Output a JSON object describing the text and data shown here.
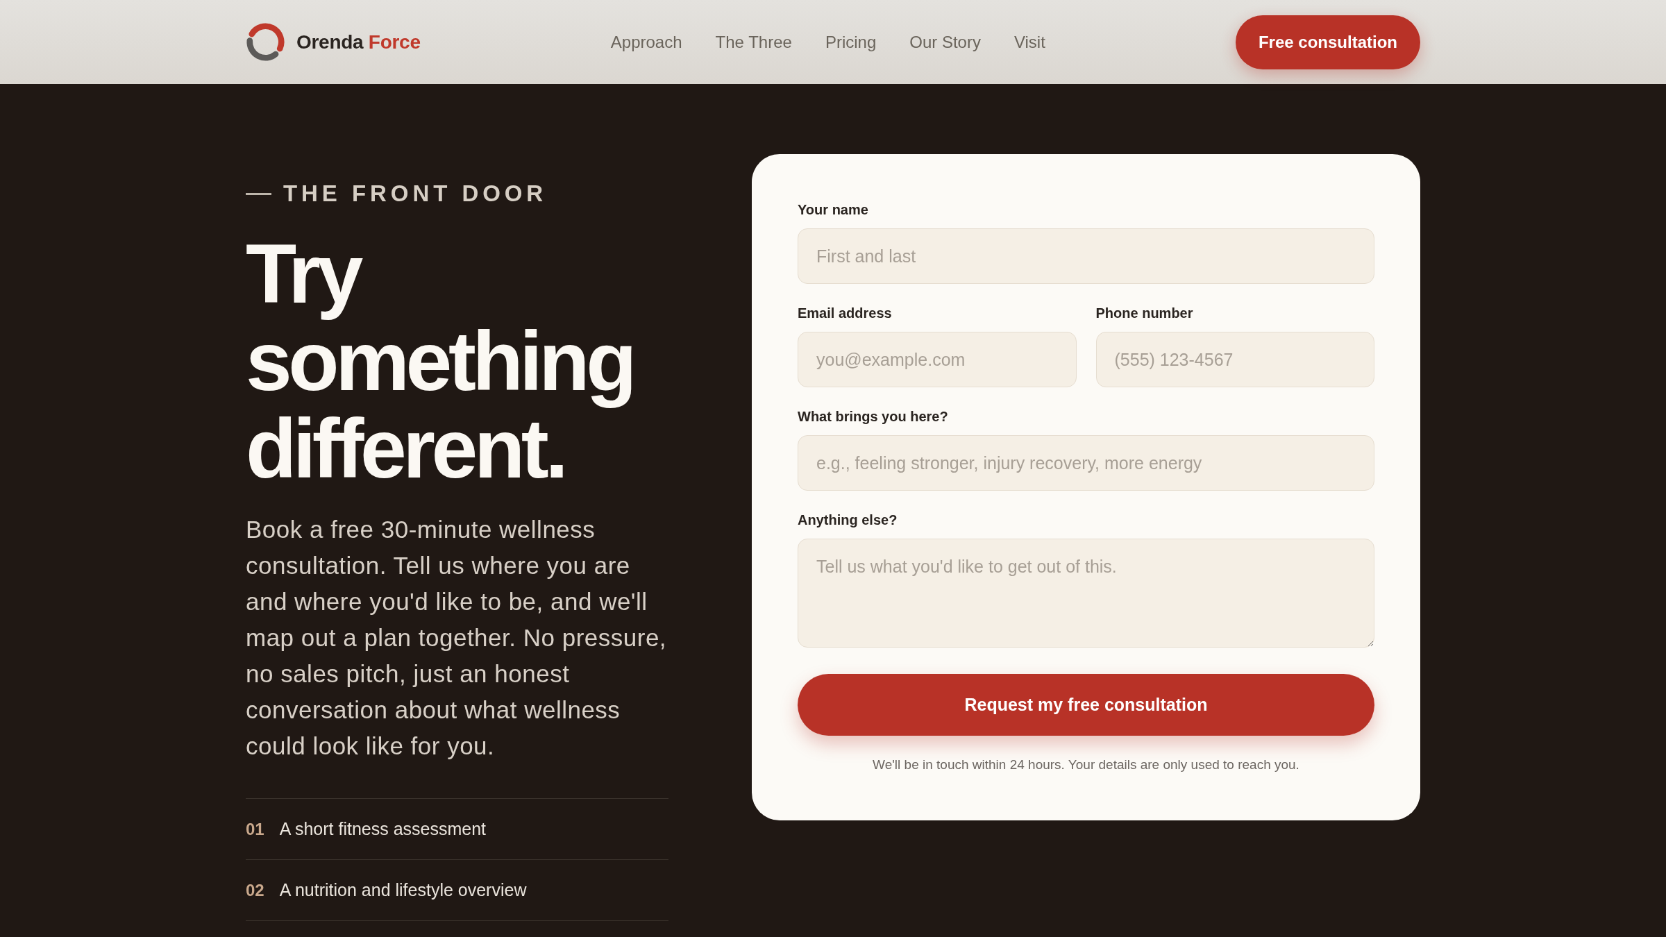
{
  "header": {
    "brand": {
      "name": "Orenda",
      "accent": "Force"
    },
    "nav": [
      {
        "label": "Approach"
      },
      {
        "label": "The Three"
      },
      {
        "label": "Pricing"
      },
      {
        "label": "Our Story"
      },
      {
        "label": "Visit"
      }
    ],
    "cta": "Free consultation"
  },
  "hero": {
    "eyebrow": "THE FRONT DOOR",
    "title": "Try something different.",
    "intro": "Book a free 30-minute wellness consultation. Tell us where you are and where you'd like to be, and we'll map out a plan together. No pressure, no sales pitch, just an honest conversation about what wellness could look like for you.",
    "steps": [
      {
        "number": "01",
        "text": "A short fitness assessment"
      },
      {
        "number": "02",
        "text": "A nutrition and lifestyle overview"
      }
    ]
  },
  "form": {
    "rows": [
      {
        "fields": [
          {
            "kind": "text",
            "label": "Your name",
            "placeholder": "First and last"
          }
        ]
      },
      {
        "fields": [
          {
            "kind": "email",
            "label": "Email address",
            "placeholder": "you@example.com"
          },
          {
            "kind": "tel",
            "label": "Phone number",
            "placeholder": "(555) 123-4567"
          }
        ]
      },
      {
        "fields": [
          {
            "kind": "text",
            "label": "What brings you here?",
            "placeholder": "e.g., feeling stronger, injury recovery, more energy"
          }
        ]
      },
      {
        "fields": [
          {
            "kind": "textarea",
            "label": "Anything else?",
            "placeholder": "Tell us what you'd like to get out of this."
          }
        ]
      }
    ],
    "submit": "Request my free consultation",
    "note": "We'll be in touch within 24 hours. Your details are only used to reach you."
  }
}
